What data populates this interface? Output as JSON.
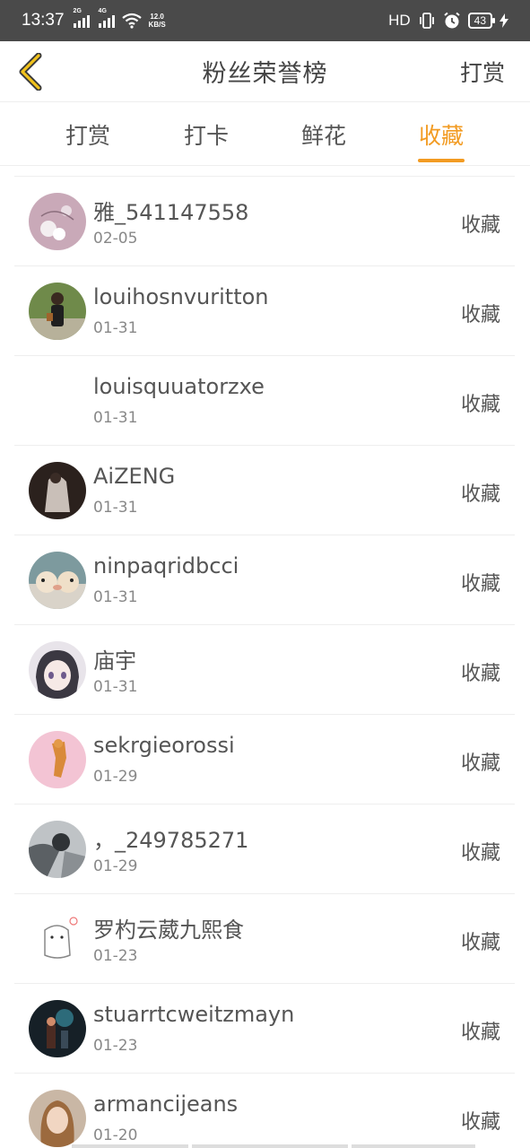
{
  "status_bar": {
    "time": "13:37",
    "signal1_label": "2G",
    "signal2_label": "4G",
    "net_speed_value": "12.0",
    "net_speed_unit": "KB/S",
    "hd_label": "HD",
    "battery": "43"
  },
  "header": {
    "title": "粉丝荣誉榜",
    "action_label": "打赏"
  },
  "tabs": [
    {
      "label": "打赏"
    },
    {
      "label": "打卡"
    },
    {
      "label": "鲜花"
    },
    {
      "label": "收藏"
    }
  ],
  "active_tab": "收藏",
  "accent_color": "#f29b22",
  "list": [
    {
      "name": "雅_541147558",
      "date": "02-05",
      "action": "收藏"
    },
    {
      "name": "louihosnvuritton",
      "date": "01-31",
      "action": "收藏"
    },
    {
      "name": "louisquuatorzxe",
      "date": "01-31",
      "action": "收藏"
    },
    {
      "name": "AiZENG",
      "date": "01-31",
      "action": "收藏"
    },
    {
      "name": "ninpaqridbcci",
      "date": "01-31",
      "action": "收藏"
    },
    {
      "name": "庙宇",
      "date": "01-31",
      "action": "收藏"
    },
    {
      "name": "sekrgieorossi",
      "date": "01-29",
      "action": "收藏"
    },
    {
      "name": "，_249785271",
      "date": "01-29",
      "action": "收藏"
    },
    {
      "name": "罗杓云葳九熙食",
      "date": "01-23",
      "action": "收藏"
    },
    {
      "name": "stuarrtcweitzmayn",
      "date": "01-23",
      "action": "收藏"
    },
    {
      "name": "armancijeans",
      "date": "01-20",
      "action": "收藏"
    }
  ]
}
